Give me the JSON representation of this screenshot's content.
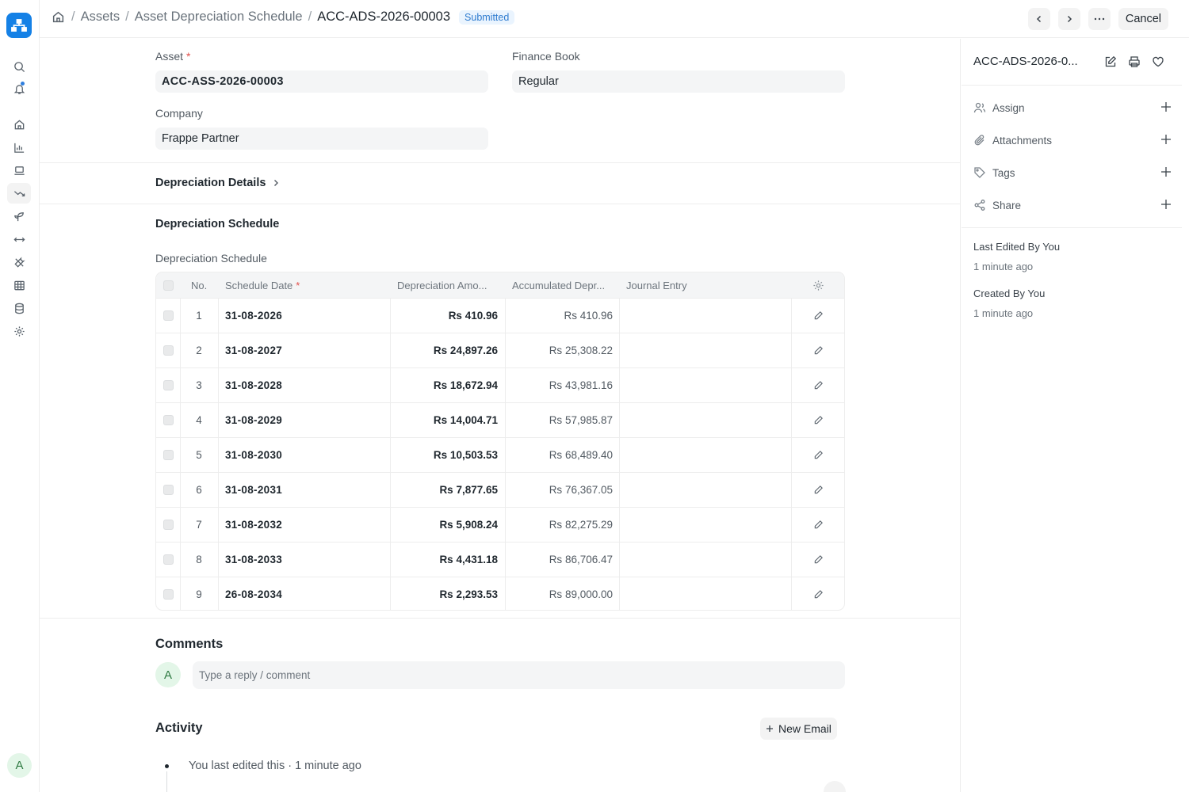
{
  "rail": {
    "items": [
      "search-icon",
      "bell-icon",
      "home-icon",
      "chart-icon",
      "laptop-icon",
      "trend-icon",
      "seedling-icon",
      "arrows-icon",
      "tools-icon",
      "table-icon",
      "database-icon",
      "gear-icon"
    ],
    "avatar_initial": "A"
  },
  "breadcrumb": {
    "items": [
      "Assets",
      "Asset Depreciation Schedule"
    ],
    "current": "ACC-ADS-2026-00003",
    "status": "Submitted"
  },
  "header": {
    "cancel_label": "Cancel"
  },
  "form": {
    "asset_label": "Asset",
    "asset_value": "ACC-ASS-2026-00003",
    "finance_book_label": "Finance Book",
    "finance_book_value": "Regular",
    "company_label": "Company",
    "company_value": "Frappe Partner",
    "depreciation_details_label": "Depreciation Details",
    "schedule_section_title": "Depreciation Schedule",
    "schedule_table_label": "Depreciation Schedule"
  },
  "schedule": {
    "columns": [
      "No.",
      "Schedule Date",
      "Depreciation Amo...",
      "Accumulated Depr...",
      "Journal Entry"
    ],
    "rows": [
      {
        "no": "1",
        "date": "31-08-2026",
        "amount": "Rs 410.96",
        "accumulated": "Rs 410.96",
        "journal": ""
      },
      {
        "no": "2",
        "date": "31-08-2027",
        "amount": "Rs 24,897.26",
        "accumulated": "Rs 25,308.22",
        "journal": ""
      },
      {
        "no": "3",
        "date": "31-08-2028",
        "amount": "Rs 18,672.94",
        "accumulated": "Rs 43,981.16",
        "journal": ""
      },
      {
        "no": "4",
        "date": "31-08-2029",
        "amount": "Rs 14,004.71",
        "accumulated": "Rs 57,985.87",
        "journal": ""
      },
      {
        "no": "5",
        "date": "31-08-2030",
        "amount": "Rs 10,503.53",
        "accumulated": "Rs 68,489.40",
        "journal": ""
      },
      {
        "no": "6",
        "date": "31-08-2031",
        "amount": "Rs 7,877.65",
        "accumulated": "Rs 76,367.05",
        "journal": ""
      },
      {
        "no": "7",
        "date": "31-08-2032",
        "amount": "Rs 5,908.24",
        "accumulated": "Rs 82,275.29",
        "journal": ""
      },
      {
        "no": "8",
        "date": "31-08-2033",
        "amount": "Rs 4,431.18",
        "accumulated": "Rs 86,706.47",
        "journal": ""
      },
      {
        "no": "9",
        "date": "26-08-2034",
        "amount": "Rs 2,293.53",
        "accumulated": "Rs 89,000.00",
        "journal": ""
      }
    ]
  },
  "comments": {
    "title": "Comments",
    "avatar_initial": "A",
    "placeholder": "Type a reply / comment"
  },
  "activity": {
    "title": "Activity",
    "new_email_label": "New Email",
    "entry": "You last edited this · 1 minute ago"
  },
  "sidebar": {
    "title": "ACC-ADS-2026-0...",
    "actions": [
      "Assign",
      "Attachments",
      "Tags",
      "Share"
    ],
    "last_edited_label": "Last Edited By You",
    "last_edited_time": "1 minute ago",
    "created_label": "Created By You",
    "created_time": "1 minute ago"
  },
  "colors": {
    "accent": "#1581e6",
    "badge_bg": "#eaf4fe",
    "badge_text": "#2e7bcf"
  }
}
